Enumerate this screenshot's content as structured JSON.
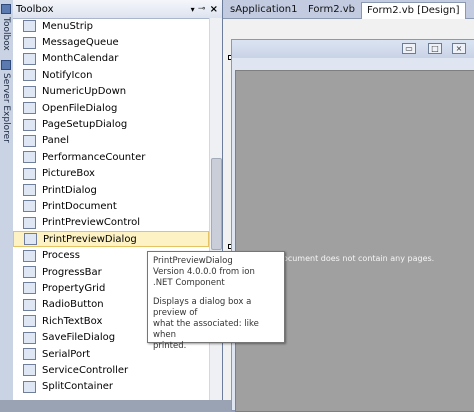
{
  "side_tabs": [
    {
      "label": "Toolbox",
      "icon": "toolbox-icon"
    },
    {
      "label": "Server Explorer",
      "icon": "server-explorer-icon"
    }
  ],
  "toolbox": {
    "title": "Toolbox",
    "pin_glyph": "⊸",
    "close_glyph": "×",
    "dropdown_glyph": "▾",
    "items": [
      {
        "label": "MenuStrip",
        "icon": "menustrip-icon"
      },
      {
        "label": "MessageQueue",
        "icon": "messagequeue-icon"
      },
      {
        "label": "MonthCalendar",
        "icon": "monthcalendar-icon"
      },
      {
        "label": "NotifyIcon",
        "icon": "notifyicon-icon"
      },
      {
        "label": "NumericUpDown",
        "icon": "numericupdown-icon"
      },
      {
        "label": "OpenFileDialog",
        "icon": "openfiledialog-icon"
      },
      {
        "label": "PageSetupDialog",
        "icon": "pagesetupdialog-icon"
      },
      {
        "label": "Panel",
        "icon": "panel-icon"
      },
      {
        "label": "PerformanceCounter",
        "icon": "performancecounter-icon"
      },
      {
        "label": "PictureBox",
        "icon": "picturebox-icon"
      },
      {
        "label": "PrintDialog",
        "icon": "printdialog-icon"
      },
      {
        "label": "PrintDocument",
        "icon": "printdocument-icon"
      },
      {
        "label": "PrintPreviewControl",
        "icon": "printpreviewcontrol-icon"
      },
      {
        "label": "PrintPreviewDialog",
        "icon": "printpreviewdialog-icon",
        "selected": true
      },
      {
        "label": "Process",
        "icon": "process-icon"
      },
      {
        "label": "ProgressBar",
        "icon": "progressbar-icon"
      },
      {
        "label": "PropertyGrid",
        "icon": "propertygrid-icon"
      },
      {
        "label": "RadioButton",
        "icon": "radiobutton-icon"
      },
      {
        "label": "RichTextBox",
        "icon": "richtextbox-icon"
      },
      {
        "label": "SaveFileDialog",
        "icon": "savefiledialog-icon"
      },
      {
        "label": "SerialPort",
        "icon": "serialport-icon"
      },
      {
        "label": "ServiceController",
        "icon": "servicecontroller-icon"
      },
      {
        "label": "SplitContainer",
        "icon": "splitcontainer-icon"
      }
    ]
  },
  "doc_tabs": [
    "sApplication1",
    "Form2.vb",
    "Form2.vb [Design]"
  ],
  "form": {
    "caption_buttons": [
      "▭",
      "□",
      "×"
    ],
    "preview_message": "Document does not contain any pages."
  },
  "tooltip": {
    "line1": "PrintPreviewDialog",
    "line2": "Version 4.0.0.0 from ion",
    "line3": ".NET Component",
    "desc1": "Displays a dialog box a preview of",
    "desc2": "what the associated: like when",
    "desc3": "printed."
  },
  "colors": {
    "selection_bg": "#fdf2c4",
    "selection_border": "#e5c365",
    "preview_gray": "#a0a0a0"
  }
}
